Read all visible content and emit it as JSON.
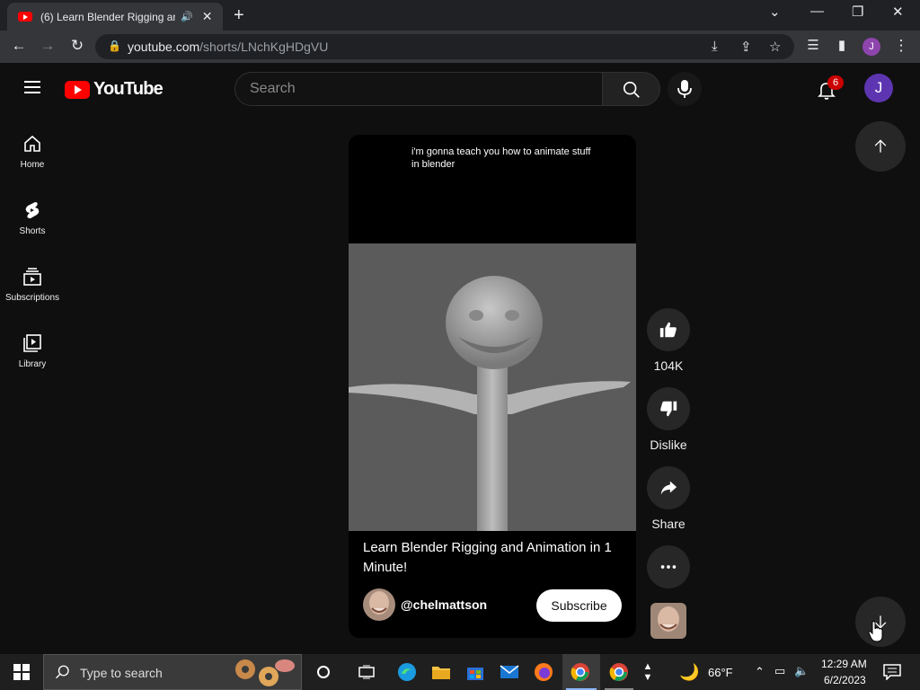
{
  "browser": {
    "tab_title": "(6) Learn Blender Rigging and Animation in 1 Minute!",
    "url_host": "youtube.com",
    "url_path": "/shorts/LNchKgHDgVU",
    "profile_initial": "J"
  },
  "masthead": {
    "logo_text": "YouTube",
    "search_placeholder": "Search",
    "notification_count": "6",
    "avatar_initial": "J"
  },
  "guide": {
    "items": [
      {
        "label": "Home",
        "icon": "home-icon"
      },
      {
        "label": "Shorts",
        "icon": "shorts-icon"
      },
      {
        "label": "Subscriptions",
        "icon": "subscriptions-icon"
      },
      {
        "label": "Library",
        "icon": "library-icon"
      }
    ]
  },
  "short": {
    "caption": "i'm gonna teach you how to animate stuff in blender",
    "title": "Learn Blender Rigging and Animation in 1 Minute!",
    "channel": "@chelmattson",
    "subscribe_label": "Subscribe"
  },
  "actions": {
    "like_count": "104K",
    "dislike_label": "Dislike",
    "share_label": "Share"
  },
  "taskbar": {
    "search_placeholder": "Type to search",
    "weather": "66°F",
    "time": "12:29 AM",
    "date": "6/2/2023"
  },
  "colors": {
    "brand_red": "#ff0000",
    "background": "#0f0f0f",
    "button_bg": "#272727"
  }
}
